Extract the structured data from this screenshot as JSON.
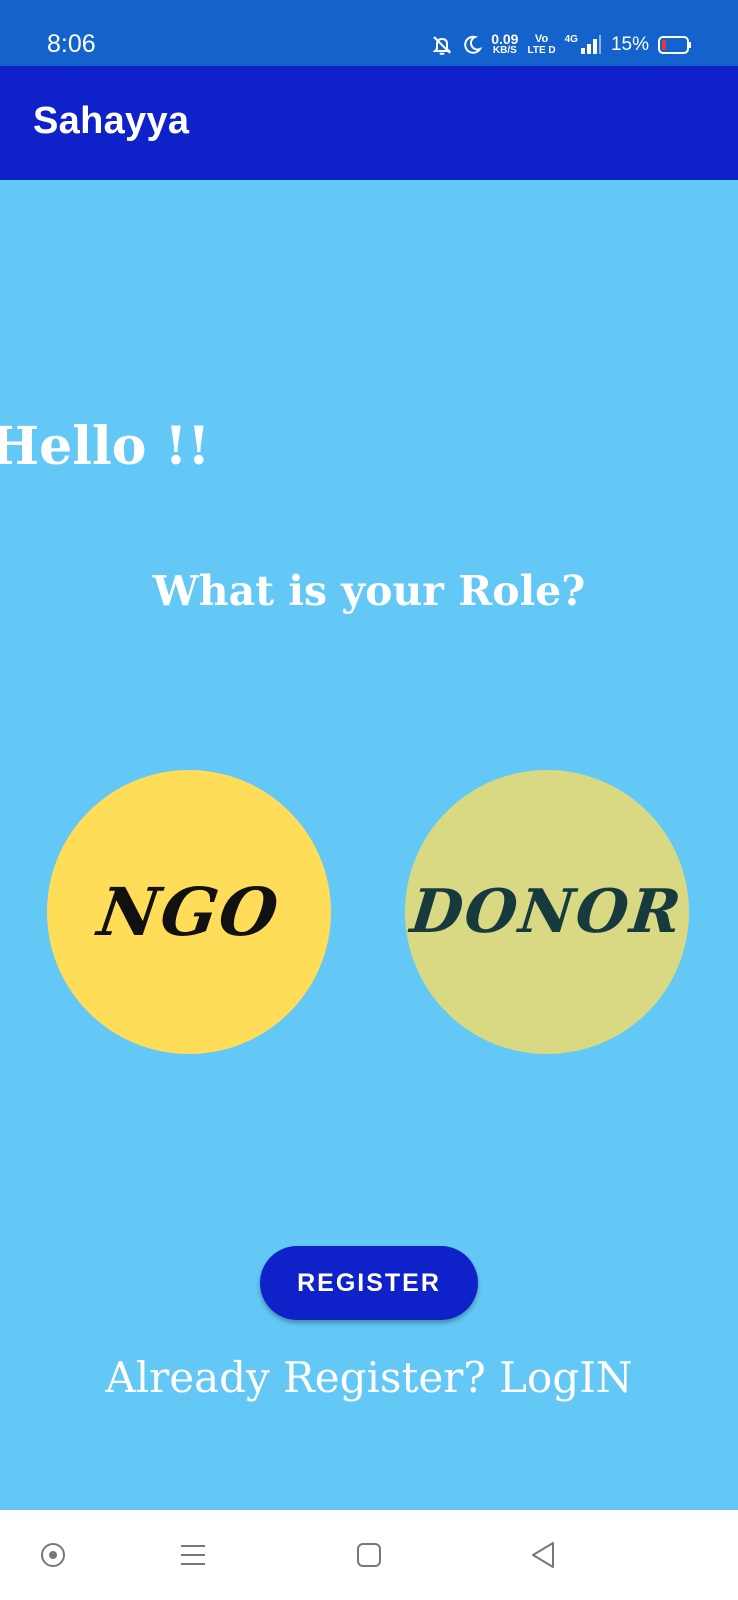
{
  "status_bar": {
    "time": "8:06",
    "net_speed_value": "0.09",
    "net_speed_unit": "KB/S",
    "volte_top": "Vo",
    "volte_bottom": "LTE D",
    "network_type": "4G",
    "battery_percent": "15%",
    "icons": [
      "mute-bell-icon",
      "moon-icon",
      "signal-icon",
      "battery-icon"
    ]
  },
  "app_bar": {
    "title": "Sahayya"
  },
  "main": {
    "greeting": "Hello !!",
    "question": "What is your Role?",
    "roles": [
      {
        "label": "NGO",
        "color": "#ffdd59"
      },
      {
        "label": "DONOR",
        "color": "#d8d982"
      }
    ],
    "register_label": "REGISTER",
    "login_prompt": "Already Register? LogIN"
  },
  "nav_bar": {
    "items": [
      "assistant-icon",
      "menu-icon",
      "home-square-icon",
      "back-triangle-icon"
    ]
  },
  "colors": {
    "status_bar": "#1463cc",
    "app_bar": "#0f21c8",
    "background": "#63c8f6",
    "button": "#0f21c8"
  }
}
